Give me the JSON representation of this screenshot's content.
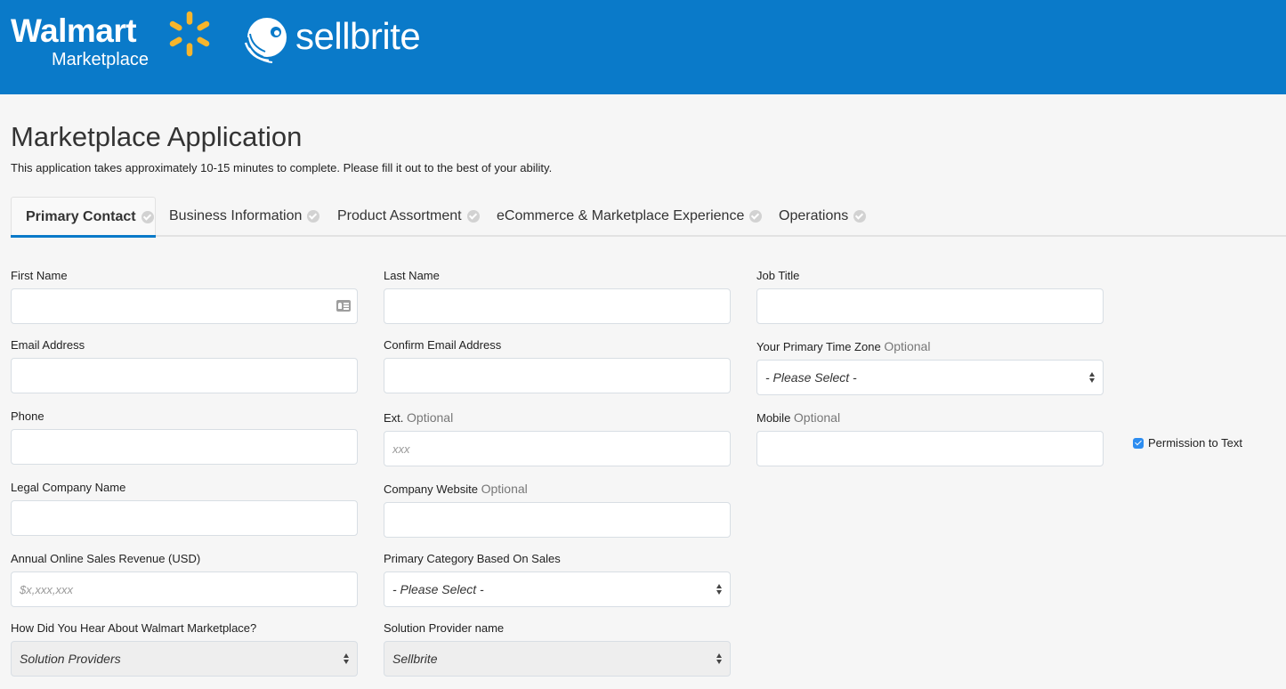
{
  "header": {
    "walmart_logo": {
      "word": "Walmart",
      "sub": "Marketplace"
    },
    "sellbrite_logo": {
      "word": "sellbrite"
    },
    "colors": {
      "brand_blue": "#0a7ac9",
      "spark_yellow": "#f7b52c"
    }
  },
  "page": {
    "title": "Marketplace Application",
    "description": "This application takes approximately 10-15 minutes to complete. Please fill it out to the best of your ability."
  },
  "tabs": [
    {
      "label": "Primary Contact",
      "active": true,
      "icon": "check-circle-icon"
    },
    {
      "label": "Business Information",
      "active": false,
      "icon": "check-circle-icon"
    },
    {
      "label": "Product Assortment",
      "active": false,
      "icon": "check-circle-icon"
    },
    {
      "label": "eCommerce & Marketplace Experience",
      "active": false,
      "icon": "check-circle-icon"
    },
    {
      "label": "Operations",
      "active": false,
      "icon": "check-circle-icon"
    }
  ],
  "form": {
    "optional_tag": "Optional",
    "first_name": {
      "label": "First Name",
      "value": "",
      "icon": "contact-card-icon"
    },
    "last_name": {
      "label": "Last Name",
      "value": ""
    },
    "job_title": {
      "label": "Job Title",
      "value": ""
    },
    "email": {
      "label": "Email Address",
      "value": ""
    },
    "confirm_email": {
      "label": "Confirm Email Address",
      "value": ""
    },
    "time_zone": {
      "label": "Your Primary Time Zone",
      "optional": true,
      "selected": "- Please Select -"
    },
    "phone": {
      "label": "Phone",
      "value": ""
    },
    "ext": {
      "label": "Ext.",
      "optional": true,
      "value": "",
      "placeholder": "xxx"
    },
    "mobile": {
      "label": "Mobile",
      "optional": true,
      "value": ""
    },
    "permission_to_text": {
      "label": "Permission to Text",
      "checked": true
    },
    "legal_company_name": {
      "label": "Legal Company Name",
      "value": ""
    },
    "company_website": {
      "label": "Company Website",
      "optional": true,
      "value": ""
    },
    "annual_revenue": {
      "label": "Annual Online Sales Revenue (USD)",
      "value": "",
      "placeholder": "$x,xxx,xxx"
    },
    "primary_category": {
      "label": "Primary Category Based On Sales",
      "selected": "- Please Select -"
    },
    "how_heard": {
      "label": "How Did You Hear About Walmart Marketplace?",
      "selected": "Solution Providers",
      "disabled": true
    },
    "solution_provider": {
      "label": "Solution Provider name",
      "selected": "Sellbrite",
      "disabled": true
    }
  }
}
